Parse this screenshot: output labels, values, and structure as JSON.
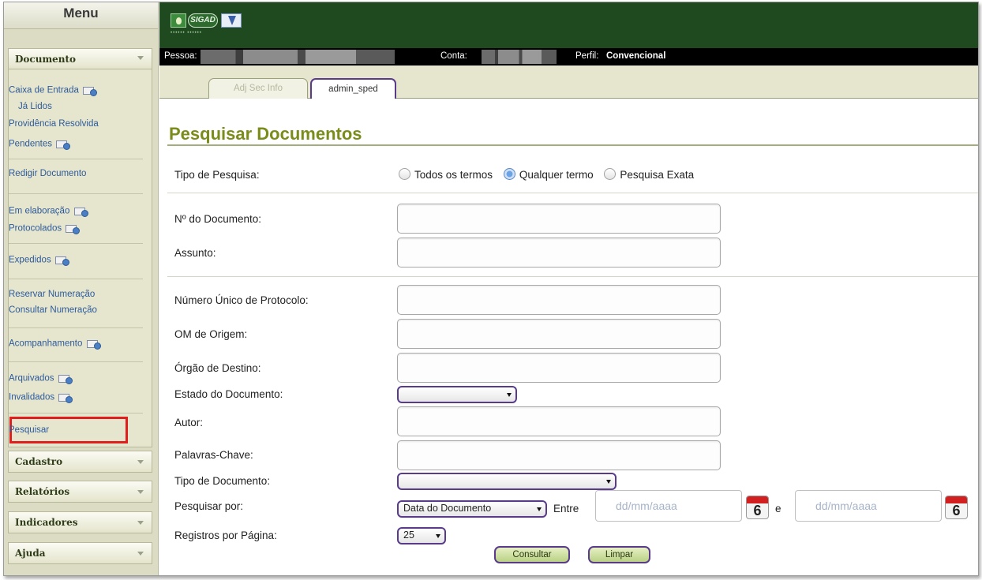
{
  "sidebar": {
    "title": "Menu",
    "documento": {
      "header": "Documento",
      "items": [
        {
          "label": "Caixa de Entrada",
          "icon": "mail-icon"
        },
        {
          "label": "Já Lidos"
        },
        {
          "label": "Providência Resolvida"
        },
        {
          "label": "Pendentes",
          "icon": "mail-icon"
        },
        {
          "label": "Redigir Documento"
        },
        {
          "label": "Em elaboração",
          "icon": "mail-icon"
        },
        {
          "label": "Protocolados",
          "icon": "mail-icon"
        },
        {
          "label": "Expedidos",
          "icon": "mail-icon"
        },
        {
          "label": "Reservar Numeração"
        },
        {
          "label": "Consultar Numeração"
        },
        {
          "label": "Acompanhamento",
          "icon": "mail-icon"
        },
        {
          "label": "Arquivados",
          "icon": "mail-icon"
        },
        {
          "label": "Invalidados",
          "icon": "mail-icon"
        },
        {
          "label": "Pesquisar",
          "highlighted": true
        }
      ]
    },
    "sections": [
      {
        "label": "Cadastro"
      },
      {
        "label": "Relatórios"
      },
      {
        "label": "Indicadores"
      },
      {
        "label": "Ajuda"
      }
    ]
  },
  "header": {
    "logo_text": "SIGAD"
  },
  "userbar": {
    "pessoa_label": "Pessoa:",
    "conta_label": "Conta:",
    "perfil_label": "Perfil:",
    "perfil_value": "Convencional"
  },
  "tabs": [
    {
      "label": "Adj Sec Info",
      "active": false
    },
    {
      "label": "admin_sped",
      "active": true
    }
  ],
  "page": {
    "title": "Pesquisar Documentos"
  },
  "form": {
    "tipo_pesquisa": {
      "label": "Tipo de Pesquisa:",
      "options": [
        "Todos os termos",
        "Qualquer termo",
        "Pesquisa Exata"
      ],
      "selected": "Qualquer termo"
    },
    "numero_documento": {
      "label": "Nº do Documento:",
      "value": ""
    },
    "assunto": {
      "label": "Assunto:",
      "value": ""
    },
    "numero_protocolo": {
      "label": "Número Único de Protocolo:",
      "value": ""
    },
    "om_origem": {
      "label": "OM de Origem:",
      "value": ""
    },
    "orgao_destino": {
      "label": "Órgão de Destino:",
      "value": ""
    },
    "estado_documento": {
      "label": "Estado do Documento:",
      "selected": ""
    },
    "autor": {
      "label": "Autor:",
      "value": ""
    },
    "palavras_chave": {
      "label": "Palavras-Chave:",
      "value": ""
    },
    "tipo_documento": {
      "label": "Tipo de Documento:",
      "selected": ""
    },
    "pesquisar_por": {
      "label": "Pesquisar por:",
      "selected": "Data do Documento",
      "entre_label": "Entre",
      "e_label": "e",
      "date_from_placeholder": "dd/mm/aaaa",
      "date_to_placeholder": "dd/mm/aaaa",
      "calendar_day": "6"
    },
    "registros_por_pagina": {
      "label": "Registros por Página:",
      "selected": "25"
    },
    "consultar_label": "Consultar",
    "limpar_label": "Limpar"
  },
  "colors": {
    "header_bg": "#1f4a1f",
    "title_color": "#7b8c1a",
    "link_color": "#2d5a9a",
    "highlight_border": "#e01e1e",
    "control_border": "#5a3a8a"
  }
}
